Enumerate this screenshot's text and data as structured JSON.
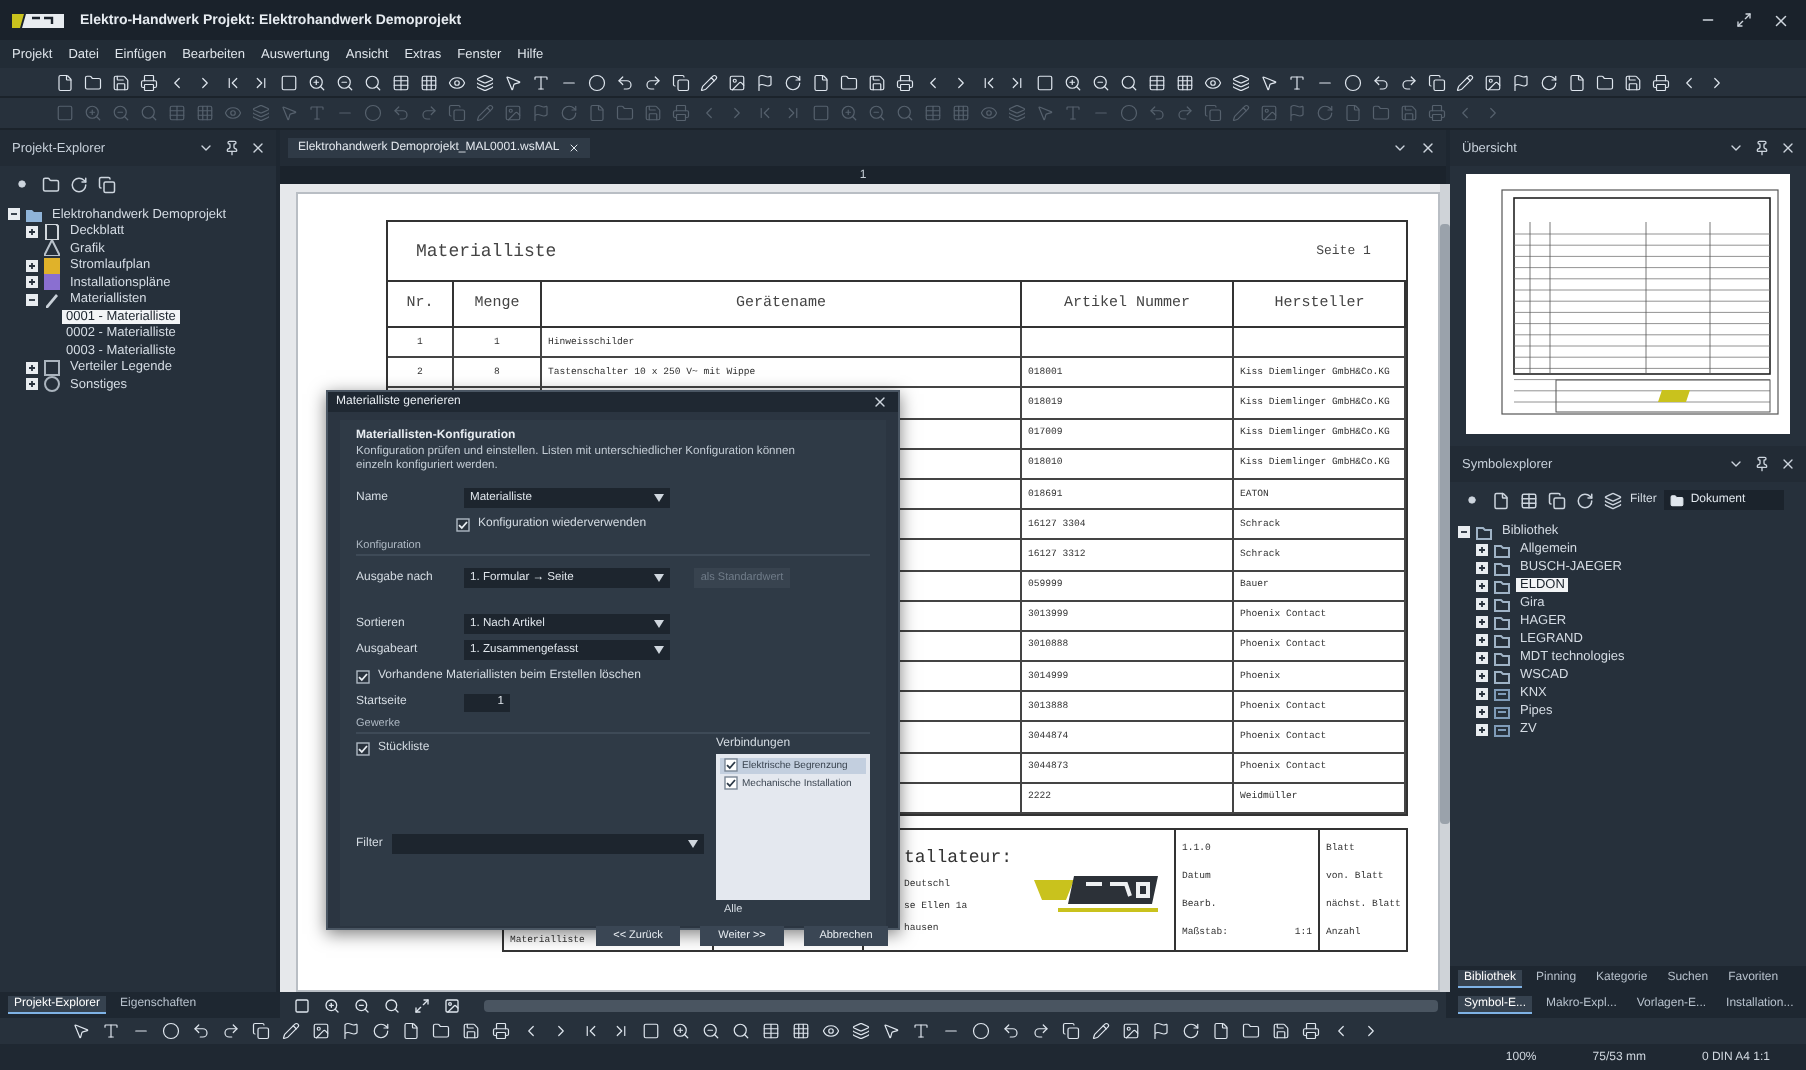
{
  "window": {
    "title": "Elektro-Handwerk  Projekt: Elektrohandwerk Demoprojekt"
  },
  "menu": [
    "Projekt",
    "Datei",
    "Einfügen",
    "Bearbeiten",
    "Auswertung",
    "Ansicht",
    "Extras",
    "Fenster",
    "Hilfe"
  ],
  "project_explorer": {
    "title": "Projekt-Explorer",
    "tree": [
      {
        "label": "Elektrohandwerk Demoprojekt",
        "kind": "project",
        "expanded": true,
        "selected": false,
        "children": [
          {
            "label": "Deckblatt",
            "kind": "page",
            "expanded": false,
            "selected": false
          },
          {
            "label": "Grafik",
            "kind": "graphic",
            "selected": false
          },
          {
            "label": "Stromlaufplan",
            "kind": "schematic",
            "expanded": false,
            "selected": false
          },
          {
            "label": "Installationspläne",
            "kind": "installation",
            "expanded": false,
            "selected": false
          },
          {
            "label": "Materiallisten",
            "kind": "list",
            "expanded": true,
            "selected": false,
            "children": [
              {
                "label": "0001 - Materialliste",
                "selected": true
              },
              {
                "label": "0002 - Materialliste",
                "selected": false
              },
              {
                "label": "0003 - Materialliste",
                "selected": false
              }
            ]
          },
          {
            "label": "Verteiler Legende",
            "kind": "legend",
            "expanded": false,
            "selected": false
          },
          {
            "label": "Sonstiges",
            "kind": "misc",
            "expanded": false,
            "selected": false
          }
        ]
      }
    ],
    "tabs": [
      {
        "label": "Projekt-Explorer",
        "selected": true
      },
      {
        "label": "Eigenschaften",
        "selected": false
      }
    ]
  },
  "document": {
    "tab": "Elektrohandwerk Demoprojekt_MAL0001.wsMAL",
    "ruler_mark": "1",
    "sheet": {
      "title": "Materialliste",
      "page_label": "Seite",
      "page_number": "1",
      "columns": [
        "Nr.",
        "Menge",
        "Gerätename",
        "Artikel Nummer",
        "Hersteller"
      ],
      "rows": [
        {
          "nr": "1",
          "qty": "1",
          "name": "Hinweisschilder"
        },
        {
          "nr": "2",
          "qty": "8",
          "name": "Tastenschalter 10 x 250 V~ mit Wippe",
          "article": "018001",
          "maker": "Kiss Diemlinger GmbH&Co.KG"
        },
        {
          "article": "018019",
          "maker": "Kiss Diemlinger GmbH&Co.KG"
        },
        {
          "article": "017009",
          "maker": "Kiss Diemlinger GmbH&Co.KG"
        },
        {
          "article": "018010",
          "maker": "Kiss Diemlinger GmbH&Co.KG"
        },
        {
          "article": "018691",
          "maker": "EATON"
        },
        {
          "article": "16127 3304",
          "maker": "Schrack"
        },
        {
          "article": "16127 3312",
          "maker": "Schrack"
        },
        {
          "article": "059999",
          "maker": "Bauer"
        },
        {
          "article": "3013999",
          "maker": "Phoenix Contact"
        },
        {
          "article": "3010888",
          "maker": "Phoenix Contact"
        },
        {
          "article": "3014999",
          "maker": "Phoenix"
        },
        {
          "article": "3013888",
          "maker": "Phoenix Contact"
        },
        {
          "article": "3044874",
          "maker": "Phoenix Contact"
        },
        {
          "article": "3044873",
          "maker": "Phoenix Contact"
        },
        {
          "article": "2222",
          "maker": "Weidmüller"
        }
      ],
      "footer": {
        "installer": "tallateur:",
        "address": [
          "Deutschl",
          "se Ellen 1a",
          "hausen"
        ],
        "bottom_label": "Materialliste",
        "info": [
          "1.1.0",
          "Datum",
          "Bearb."
        ],
        "scale_label": "Maßstab:",
        "scale": "1:1",
        "sheet_info": [
          "Blatt",
          "von. Blatt",
          "nächst. Blatt",
          "Anzahl"
        ]
      }
    }
  },
  "dialog": {
    "title": "Materialliste generieren",
    "heading": "Materiallisten-Konfiguration",
    "description": "Konfiguration prüfen und einstellen. Listen mit unterschiedlicher Konfiguration können einzeln konfiguriert werden.",
    "name": {
      "label": "Name",
      "value": "Materialliste"
    },
    "reuse": {
      "label": "Konfiguration wiederverwenden",
      "checked": true
    },
    "config_group": "Konfiguration",
    "output": {
      "label": "Ausgabe nach",
      "value": "1. Formular → Seite"
    },
    "default_button": {
      "label": "als Standardwert",
      "disabled": true
    },
    "sort": {
      "label": "Sortieren",
      "value": "1. Nach Artikel"
    },
    "mode": {
      "label": "Ausgabeart",
      "value": "1. Zusammengefasst"
    },
    "delete_existing": {
      "label": "Vorhandene Materiallisten beim Erstellen löschen",
      "checked": true
    },
    "start_page": {
      "label": "Startseite",
      "value": "1"
    },
    "trades_group": "Gewerke",
    "parts_list": {
      "label": "Stückliste",
      "checked": true
    },
    "connections": {
      "label": "Verbindungen",
      "all": "Alle",
      "items": [
        {
          "label": "Elektrische Begrenzung",
          "checked": true,
          "selected": true
        },
        {
          "label": "Mechanische Installation",
          "checked": true,
          "selected": false
        }
      ]
    },
    "filter": {
      "label": "Filter"
    },
    "buttons": [
      "<< Zurück",
      "Weiter >>",
      "Abbrechen"
    ]
  },
  "overview": {
    "title": "Übersicht"
  },
  "symbol_explorer": {
    "title": "Symbolexplorer",
    "filter_label": "Filter",
    "filter_value": "Dokument",
    "tree": [
      {
        "label": "Bibliothek",
        "kind": "folder",
        "expanded": true,
        "selected": false,
        "children": [
          {
            "label": "Allgemein",
            "kind": "folder",
            "expanded": false,
            "selected": false
          },
          {
            "label": "BUSCH-JAEGER",
            "kind": "folder",
            "expanded": false,
            "selected": false
          },
          {
            "label": "ELDON",
            "kind": "folder",
            "expanded": false,
            "selected": true
          },
          {
            "label": "Gira",
            "kind": "folder",
            "expanded": false,
            "selected": false
          },
          {
            "label": "HAGER",
            "kind": "folder",
            "expanded": false,
            "selected": false
          },
          {
            "label": "LEGRAND",
            "kind": "folder",
            "expanded": false,
            "selected": false
          },
          {
            "label": "MDT technologies",
            "kind": "folder",
            "expanded": false,
            "selected": false
          },
          {
            "label": "WSCAD",
            "kind": "folder",
            "expanded": false,
            "selected": false
          },
          {
            "label": "KNX",
            "kind": "macro",
            "expanded": false,
            "selected": false
          },
          {
            "label": "Pipes",
            "kind": "macro",
            "expanded": false,
            "selected": false
          },
          {
            "label": "ZV",
            "kind": "macro",
            "expanded": false,
            "selected": false
          }
        ]
      }
    ],
    "tabs": [
      {
        "label": "Bibliothek",
        "selected": true
      },
      {
        "label": "Pinning",
        "selected": false
      },
      {
        "label": "Kategorie",
        "selected": false
      },
      {
        "label": "Suchen",
        "selected": false
      },
      {
        "label": "Favoriten",
        "selected": false
      }
    ],
    "windows": [
      {
        "label": "Symbol-E...",
        "selected": true
      },
      {
        "label": "Makro-Expl...",
        "selected": false
      },
      {
        "label": "Vorlagen-E...",
        "selected": false
      },
      {
        "label": "Installation...",
        "selected": false
      }
    ]
  },
  "status_bar": [
    "100%",
    "75/53 mm",
    "0 DIN A4 1:1"
  ]
}
